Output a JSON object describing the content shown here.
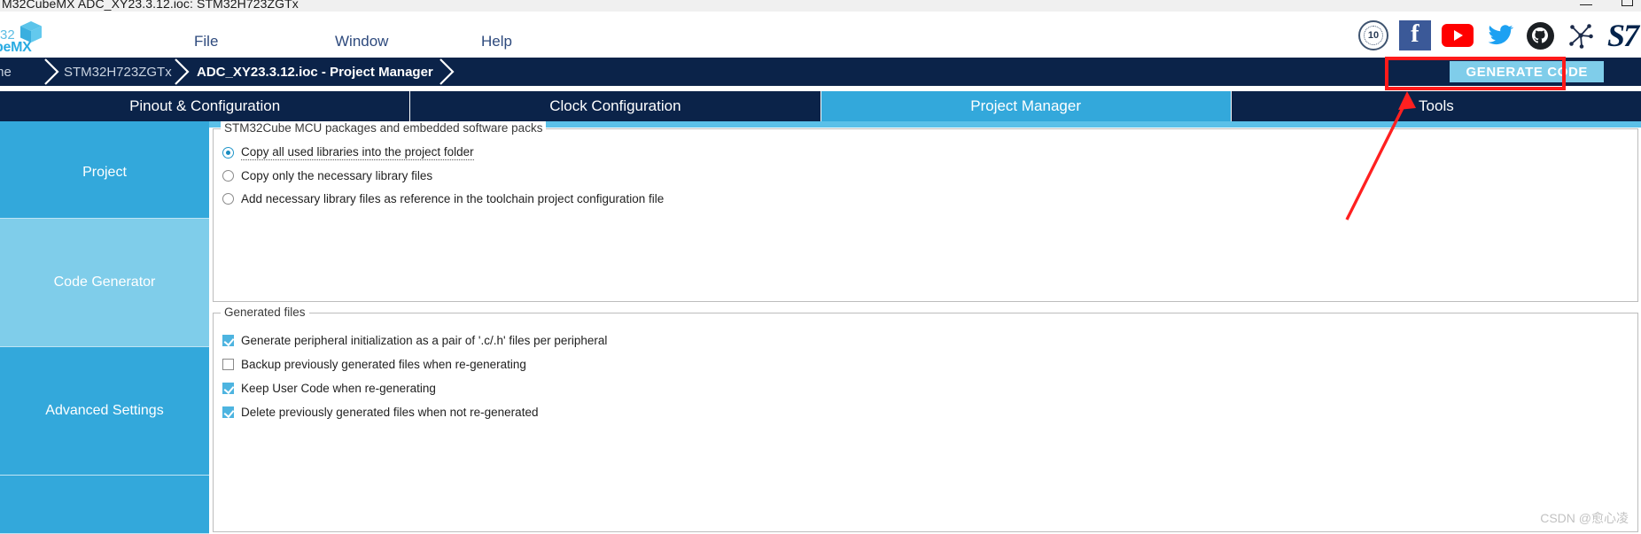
{
  "window": {
    "title": "M32CubeMX ADC_XY23.3.12.ioc: STM32H723ZGTx",
    "minimize_label": "",
    "maximize_label": ""
  },
  "logo": {
    "text_top": "32",
    "text_bottom": "beMX"
  },
  "menu": {
    "items": [
      {
        "label": "File"
      },
      {
        "label": "Window"
      },
      {
        "label": "Help"
      }
    ]
  },
  "social": {
    "badge_years": "10",
    "facebook": "f",
    "youtube": "▶",
    "twitter": "ᴠ",
    "github": "●",
    "network": "✳",
    "st_logo": "S7"
  },
  "breadcrumb": {
    "items": [
      {
        "label": "me",
        "active": false
      },
      {
        "label": "STM32H723ZGTx",
        "active": false
      },
      {
        "label": "ADC_XY23.3.12.ioc - Project Manager",
        "active": true
      }
    ],
    "generate_code_label": "GENERATE CODE"
  },
  "tabs": [
    {
      "label": "Pinout & Configuration",
      "active": false
    },
    {
      "label": "Clock Configuration",
      "active": false
    },
    {
      "label": "Project Manager",
      "active": true
    },
    {
      "label": "Tools",
      "active": false
    }
  ],
  "sidebar": {
    "items": [
      {
        "label": "Project",
        "selected": false
      },
      {
        "label": "Code Generator",
        "selected": true
      },
      {
        "label": "Advanced Settings",
        "selected": false
      },
      {
        "label": "",
        "selected": false
      }
    ]
  },
  "main": {
    "packages_group": {
      "legend": "STM32Cube MCU packages and embedded software packs",
      "options": [
        {
          "label": "Copy all used libraries into the project folder",
          "selected": true
        },
        {
          "label": "Copy only the necessary library files",
          "selected": false
        },
        {
          "label": "Add necessary library files as reference in the toolchain project configuration file",
          "selected": false
        }
      ]
    },
    "generated_group": {
      "legend": "Generated files",
      "options": [
        {
          "label": "Generate peripheral initialization as a pair of '.c/.h' files per peripheral",
          "checked": true
        },
        {
          "label": "Backup previously generated files when re-generating",
          "checked": false
        },
        {
          "label": "Keep User Code when re-generating",
          "checked": true
        },
        {
          "label": "Delete previously generated files when not re-generated",
          "checked": true
        }
      ]
    }
  },
  "annotations": {
    "highlight_color": "#ff1a1a",
    "arrow_color": "#ff2020"
  },
  "watermark": {
    "text": "CSDN @愈心凌"
  },
  "colors": {
    "navy": "#0b2349",
    "accent_blue": "#33a8db",
    "light_blue": "#7fcdea",
    "menu_text": "#2e4a7d",
    "st_navy": "#03234b"
  }
}
